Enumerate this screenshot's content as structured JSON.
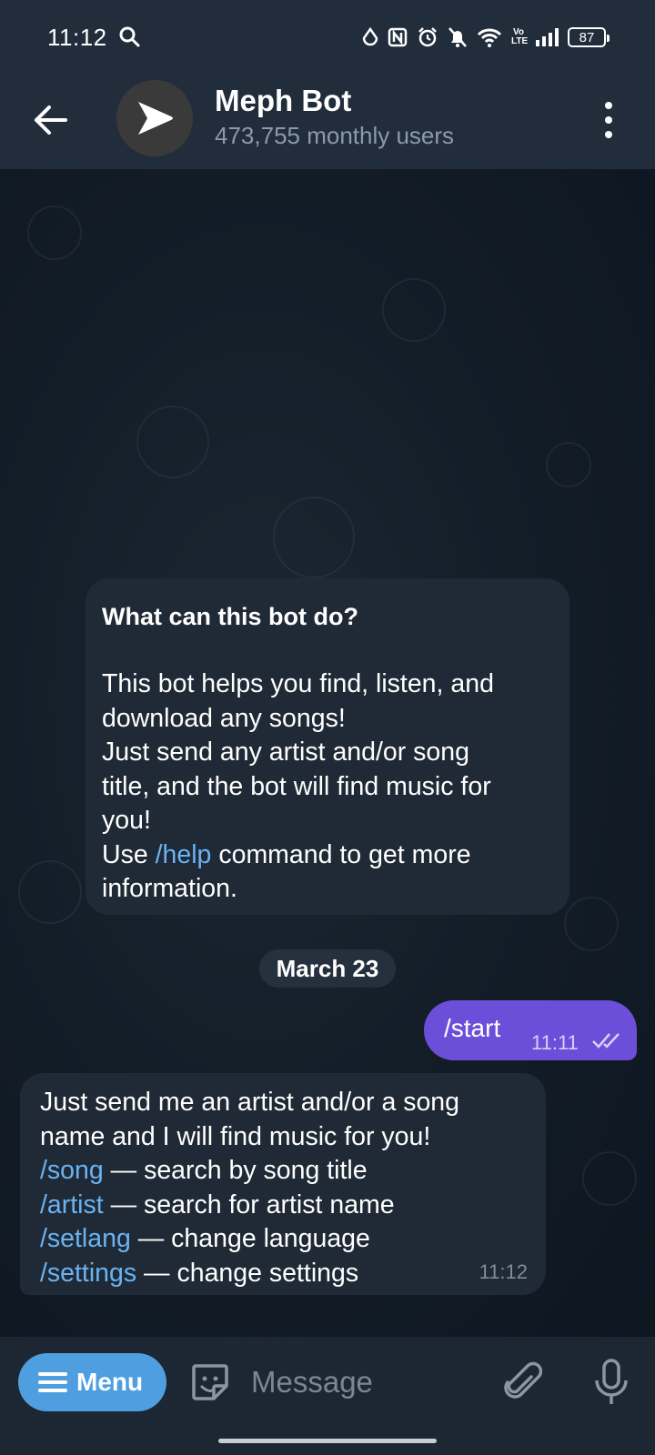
{
  "status_bar": {
    "time": "11:12",
    "battery": "87",
    "network": "Vo\nLTE",
    "icons": [
      "search-icon",
      "data-saver-icon",
      "nfc-icon",
      "alarm-icon",
      "mute-icon",
      "wifi-icon",
      "volte-icon",
      "signal-icon",
      "battery-icon"
    ]
  },
  "header": {
    "title": "Meph Bot",
    "subtitle": "473,755 monthly users",
    "icons": [
      "back-arrow-icon",
      "play-logo-icon",
      "more-vertical-icon"
    ]
  },
  "info_card": {
    "title": "What can this bot do?",
    "lines": [
      "This bot helps you find, listen, and",
      "download any songs!",
      "Just send any artist and/or song",
      "title, and the bot will find music for",
      "you!"
    ],
    "help_prefix": "Use ",
    "help_command": "/help",
    "help_suffix": " command to get more",
    "last_line": "information."
  },
  "date_separator": "March 23",
  "outgoing": {
    "text": "/start",
    "time": "11:11"
  },
  "incoming": {
    "line1": "Just send me an artist and/or a song",
    "line2": "name and I will find music for you!",
    "commands": [
      {
        "cmd": "/song",
        "desc": " — search by song title"
      },
      {
        "cmd": "/artist",
        "desc": " — search for artist name"
      },
      {
        "cmd": "/setlang",
        "desc": " — change language"
      },
      {
        "cmd": "/settings",
        "desc": " — change settings"
      }
    ],
    "time": "11:12"
  },
  "input_bar": {
    "menu_label": "Menu",
    "placeholder": "Message",
    "icons": [
      "menu-icon",
      "sticker-icon",
      "attach-icon",
      "mic-icon"
    ]
  },
  "colors": {
    "accent_link": "#6ab3f3",
    "outgoing_bubble": "#6c4fd8",
    "menu_button": "#4f9fe0",
    "header_bg": "#212d3b"
  }
}
